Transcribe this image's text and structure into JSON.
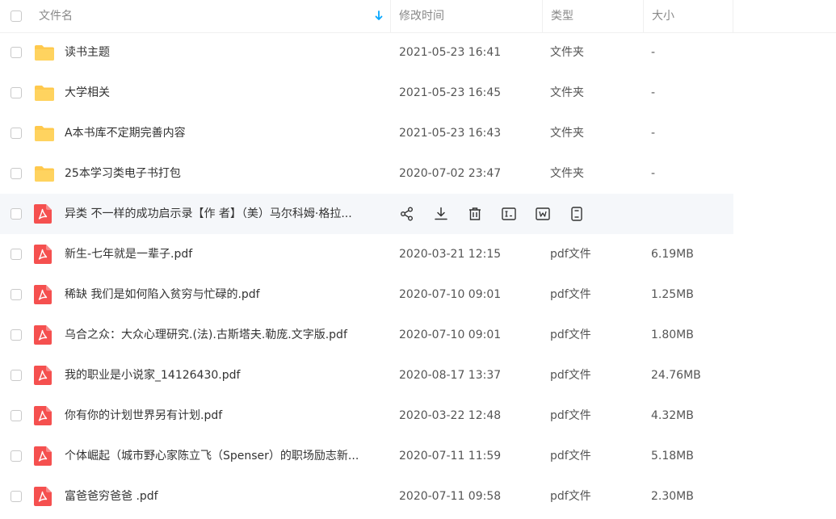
{
  "header": {
    "name_label": "文件名",
    "time_label": "修改时间",
    "type_label": "类型",
    "size_label": "大小",
    "sort_icon": "sort-down-arrow-icon"
  },
  "colors": {
    "accent": "#06a7ff",
    "folder": "#ffc94d",
    "pdf": "#f5504f"
  },
  "files": [
    {
      "name": "读书主题",
      "time": "2021-05-23 16:41",
      "type": "文件夹",
      "size": "-",
      "icon": "folder-icon"
    },
    {
      "name": "大学相关",
      "time": "2021-05-23 16:45",
      "type": "文件夹",
      "size": "-",
      "icon": "folder-icon"
    },
    {
      "name": "A本书库不定期完善内容",
      "time": "2021-05-23 16:43",
      "type": "文件夹",
      "size": "-",
      "icon": "folder-icon"
    },
    {
      "name": "25本学习类电子书打包",
      "time": "2020-07-02 23:47",
      "type": "文件夹",
      "size": "-",
      "icon": "folder-icon"
    },
    {
      "name": "异类  不一样的成功启示录【作 者】（美）马尔科姆·格拉...",
      "time": "",
      "type": "",
      "size": "",
      "icon": "pdf-icon",
      "hover": true
    },
    {
      "name": "新生-七年就是一辈子.pdf",
      "time": "2020-03-21 12:15",
      "type": "pdf文件",
      "size": "6.19MB",
      "icon": "pdf-icon"
    },
    {
      "name": "稀缺 我们是如何陷入贫穷与忙碌的.pdf",
      "time": "2020-07-10 09:01",
      "type": "pdf文件",
      "size": "1.25MB",
      "icon": "pdf-icon"
    },
    {
      "name": "乌合之众：大众心理研究.(法).古斯塔夫.勒庞.文字版.pdf",
      "time": "2020-07-10 09:01",
      "type": "pdf文件",
      "size": "1.80MB",
      "icon": "pdf-icon"
    },
    {
      "name": "我的职业是小说家_14126430.pdf",
      "time": "2020-08-17 13:37",
      "type": "pdf文件",
      "size": "24.76MB",
      "icon": "pdf-icon"
    },
    {
      "name": "你有你的计划世界另有计划.pdf",
      "time": "2020-03-22 12:48",
      "type": "pdf文件",
      "size": "4.32MB",
      "icon": "pdf-icon"
    },
    {
      "name": "个体崛起（城市野心家陈立飞（Spenser）的职场励志新...",
      "time": "2020-07-11 11:59",
      "type": "pdf文件",
      "size": "5.18MB",
      "icon": "pdf-icon"
    },
    {
      "name": "富爸爸穷爸爸 .pdf",
      "time": "2020-07-11 09:58",
      "type": "pdf文件",
      "size": "2.30MB",
      "icon": "pdf-icon"
    }
  ],
  "hover_actions": [
    "share-icon",
    "download-icon",
    "delete-icon",
    "rename-icon",
    "move-icon",
    "info-icon"
  ]
}
